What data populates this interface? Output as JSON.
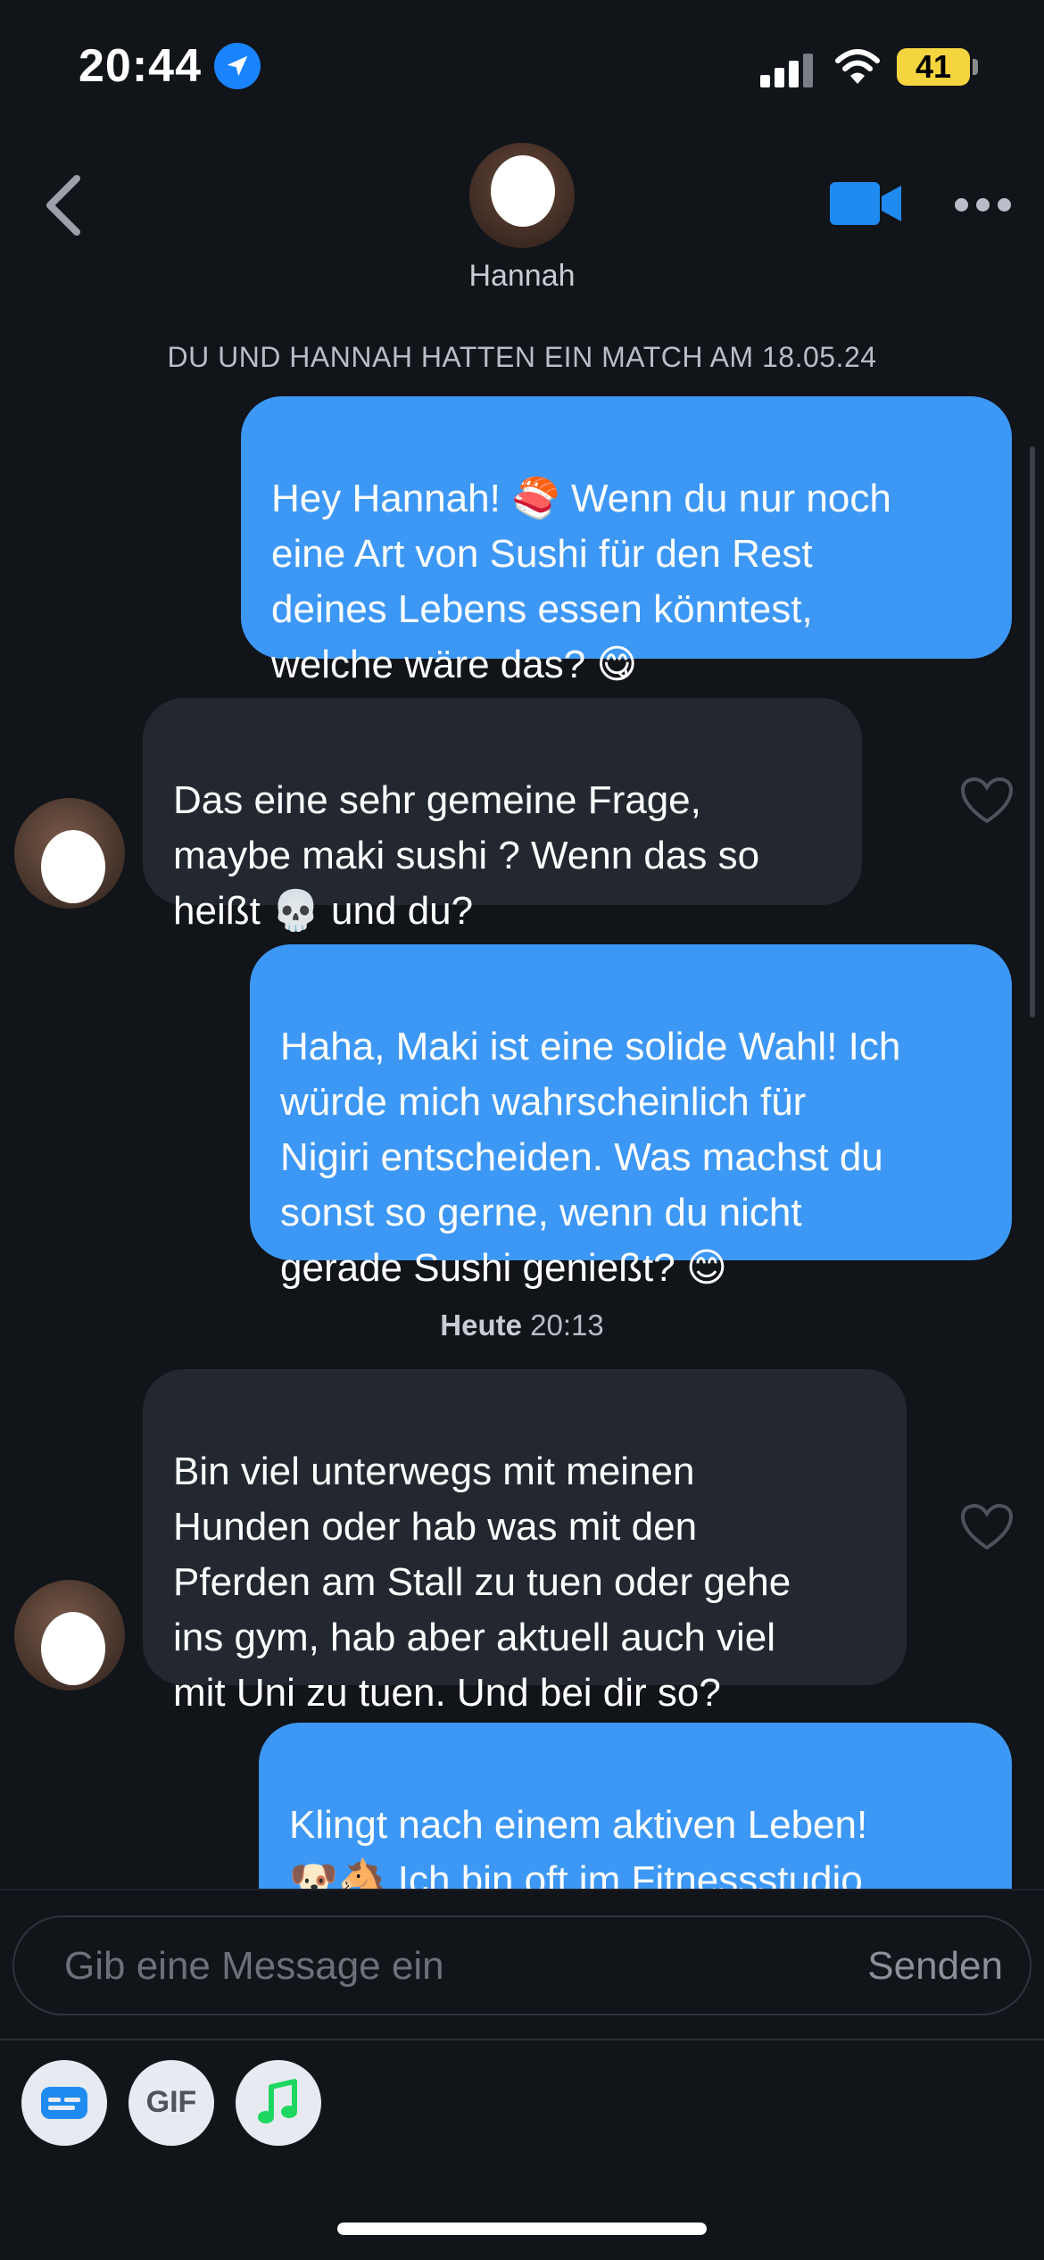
{
  "status_bar": {
    "time": "20:44",
    "battery": "41"
  },
  "header": {
    "name": "Hannah"
  },
  "match_note": "DU UND HANNAH HATTEN EIN MATCH AM 18.05.24",
  "messages": [
    {
      "direction": "out",
      "text": "Hey Hannah! 🍣 Wenn du nur noch\neine Art von Sushi für den Rest\ndeines Lebens essen könntest,\nwelche wäre das? 😋"
    },
    {
      "direction": "in",
      "text": "Das eine sehr gemeine Frage,\nmaybe maki sushi ? Wenn das so\nheißt 💀 und du?"
    },
    {
      "direction": "out",
      "text": "Haha, Maki ist eine solide Wahl! Ich\nwürde mich wahrscheinlich für\nNigiri entscheiden. Was machst du\nsonst so gerne, wenn du nicht\ngerade Sushi genießt? 😊"
    },
    {
      "direction": "in",
      "text": "Bin viel unterwegs mit meinen\nHunden oder hab was mit den\nPferden am Stall zu tuen oder gehe\nins gym, hab aber aktuell auch viel\nmit Uni zu tuen. Und bei dir so?"
    },
    {
      "direction": "out",
      "text": "Klingt nach einem aktiven Leben!\n🐶🐴 Ich bin oft im Fitnessstudio,\narbeite als Softwareentwickler und"
    }
  ],
  "timestamp": {
    "day": "Heute",
    "time": "20:13"
  },
  "composer": {
    "placeholder": "Gib eine Message ein",
    "send_label": "Senden"
  },
  "toolbar": {
    "gif_label": "GIF"
  },
  "colors": {
    "background": "#111419",
    "outgoing_bubble": "#3d98f5",
    "incoming_bubble": "#232830",
    "accent": "#1a84ff"
  },
  "icons": [
    "location-arrow-icon",
    "signal-icon",
    "wifi-icon",
    "battery-icon",
    "back-chevron-icon",
    "video-camera-icon",
    "more-dots-icon",
    "heart-icon",
    "sticker-icon",
    "gif-icon",
    "music-note-icon"
  ]
}
